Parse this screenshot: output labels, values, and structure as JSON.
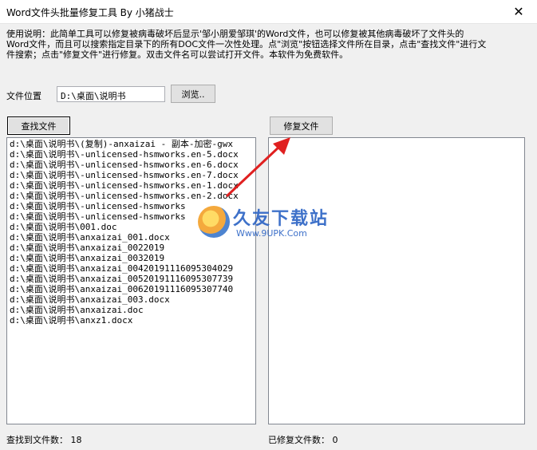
{
  "window": {
    "title": "Word文件头批量修复工具  By 小猪战士",
    "close_glyph": "✕"
  },
  "description": "使用说明：此简单工具可以修复被病毒破坏后显示'邹小朋爱邹琪'的Word文件，也可以修复被其他病毒破坏了文件头的\nWord文件，而且可以搜索指定目录下的所有DOC文件一次性处理。点\"浏览\"按钮选择文件所在目录，点击\"查找文件\"进行文\n件搜索；点击\"修复文件\"进行修复。双击文件名可以尝试打开文件。本软件为免费软件。",
  "location": {
    "label": "文件位置",
    "value": "D:\\桌面\\说明书",
    "browse_label": "浏览.."
  },
  "buttons": {
    "find_label": "查找文件",
    "repair_label": "修复文件"
  },
  "found_files": [
    "d:\\桌面\\说明书\\(复制)-anxaizai - 副本-加密-gwx",
    "d:\\桌面\\说明书\\-unlicensed-hsmworks.en-5.docx",
    "d:\\桌面\\说明书\\-unlicensed-hsmworks.en-6.docx",
    "d:\\桌面\\说明书\\-unlicensed-hsmworks.en-7.docx",
    "d:\\桌面\\说明书\\-unlicensed-hsmworks.en-1.docx",
    "d:\\桌面\\说明书\\-unlicensed-hsmworks.en-2.docx",
    "d:\\桌面\\说明书\\-unlicensed-hsmworks",
    "d:\\桌面\\说明书\\-unlicensed-hsmworks",
    "d:\\桌面\\说明书\\001.doc",
    "d:\\桌面\\说明书\\anxaizai_001.docx",
    "d:\\桌面\\说明书\\anxaizai_0022019",
    "d:\\桌面\\说明书\\anxaizai_0032019",
    "d:\\桌面\\说明书\\anxaizai_00420191116095304029",
    "d:\\桌面\\说明书\\anxaizai_00520191116095307739",
    "d:\\桌面\\说明书\\anxaizai_00620191116095307740",
    "d:\\桌面\\说明书\\anxaizai_003.docx",
    "d:\\桌面\\说明书\\anxaizai.doc",
    "d:\\桌面\\说明书\\anxz1.docx"
  ],
  "status": {
    "found_label": "查找到文件数：",
    "found_count": "18",
    "repaired_label": "已修复文件数：",
    "repaired_count": "0"
  },
  "watermark": {
    "brand": "久友下载站",
    "url": "Www.9UPK.Com"
  },
  "colors": {
    "arrow": "#e02020",
    "watermark": "#2a62c4"
  }
}
